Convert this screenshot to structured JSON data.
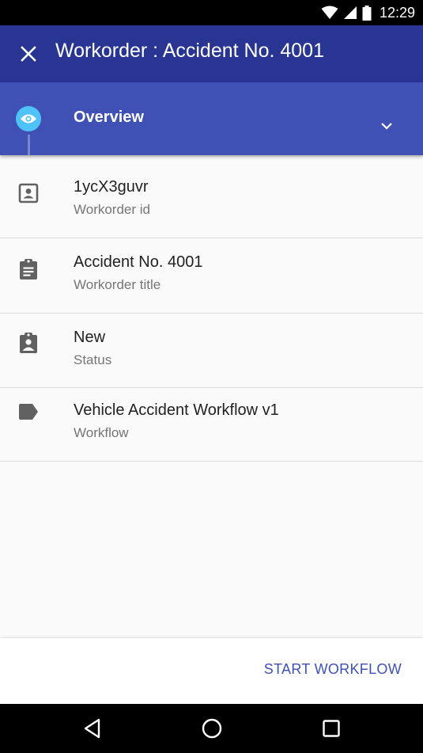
{
  "status_bar": {
    "time": "12:29",
    "icons": [
      "wifi-icon",
      "signal-icon",
      "battery-icon"
    ]
  },
  "app_bar": {
    "title": "Workorder : Accident No. 4001",
    "close_icon": "close-icon",
    "background": "#283593"
  },
  "section": {
    "title": "Overview",
    "icon": "eye-icon",
    "expand_icon": "chevron-down-icon",
    "background": "#3f51b5",
    "accent": "#4fc3f7"
  },
  "items": [
    {
      "icon": "account-box-icon",
      "primary": "1ycX3guvr",
      "secondary": "Workorder id"
    },
    {
      "icon": "clipboard-text-icon",
      "primary": "Accident No. 4001",
      "secondary": "Workorder title"
    },
    {
      "icon": "clipboard-account-icon",
      "primary": "New",
      "secondary": "Status"
    },
    {
      "icon": "label-icon",
      "primary": "Vehicle Accident Workflow v1",
      "secondary": "Workflow"
    }
  ],
  "actions": {
    "start_workflow": "START WORKFLOW"
  },
  "nav_bar": {
    "buttons": [
      "back-triangle-icon",
      "home-circle-icon",
      "recents-square-icon"
    ]
  }
}
